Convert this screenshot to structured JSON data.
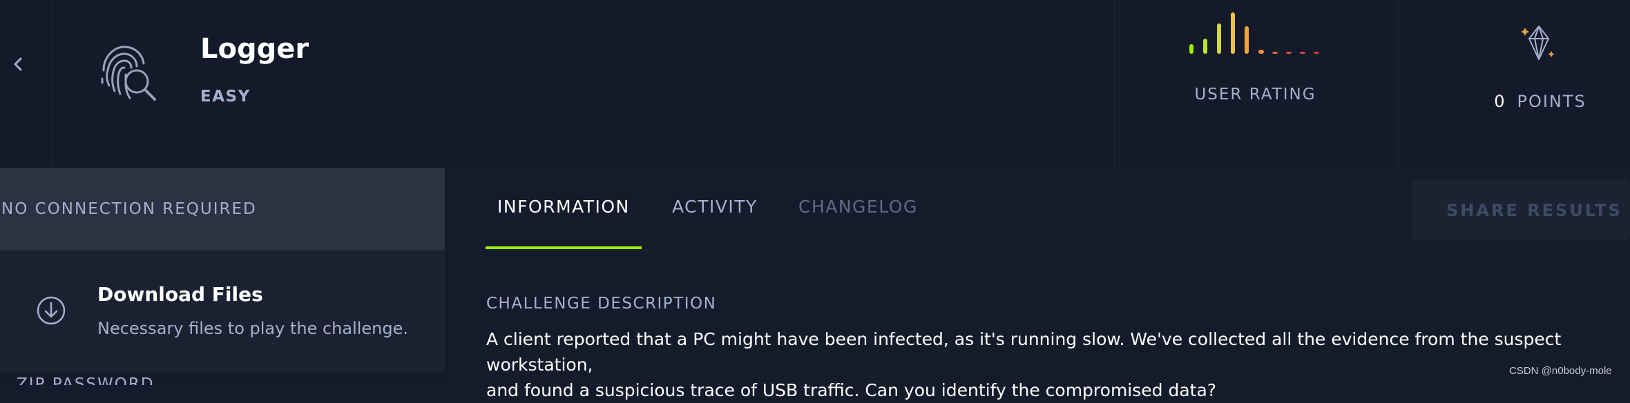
{
  "header": {
    "title": "Logger",
    "difficulty": "EASY",
    "rating_label": "USER RATING",
    "points_value": "0",
    "points_label": "POINTS",
    "rating_bar_colors": [
      "#9fef00",
      "#b8e62a",
      "#d4d83a",
      "#eec24a",
      "#f0a23c",
      "#f08a3a",
      "#e86a3a",
      "#e4583a",
      "#df4a3a",
      "#da3f3a"
    ]
  },
  "sidebar": {
    "connection": "NO CONNECTION REQUIRED",
    "download_title": "Download Files",
    "download_subtitle": "Necessary files to play the challenge.",
    "zip_label": "ZIP PASSWORD"
  },
  "tabs": [
    {
      "label": "INFORMATION",
      "active": true
    },
    {
      "label": "ACTIVITY",
      "active": false
    },
    {
      "label": "CHANGELOG",
      "active": false
    }
  ],
  "share_label": "SHARE RESULTS",
  "content": {
    "section_title": "CHALLENGE DESCRIPTION",
    "description_line1": "A client reported that a PC might have been infected, as it's running slow. We've collected all the evidence from the suspect workstation,",
    "description_line2": "and found a suspicious trace of USB traffic. Can you identify the compromised data?"
  },
  "watermark": "CSDN @n0body-mole",
  "colors": {
    "accent": "#9fef00",
    "background": "#141b2b",
    "muted_text": "#a4b1cd"
  }
}
